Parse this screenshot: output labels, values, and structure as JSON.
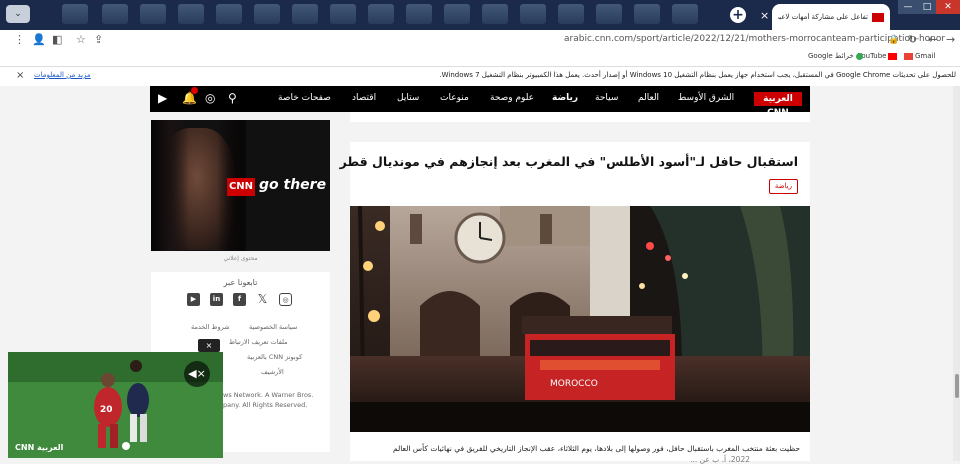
{
  "browser": {
    "tab_title": "تفاعل على مشاركة أمهات لاعبي المغرب ب...",
    "url": "arabic.cnn.com/sport/article/2022/12/21/mothers-morrocanteam-participation-honor",
    "new_tab": "+",
    "tab_close": "×",
    "window_controls": [
      "—",
      "□",
      "✕"
    ],
    "bookmarks": [
      {
        "label": "Gmail",
        "color": "#ea4335"
      },
      {
        "label": "YouTube",
        "color": "#ff0000"
      },
      {
        "label": "Google خرائط",
        "color": "#34a853"
      }
    ],
    "toolbar_icons": [
      "more-icon",
      "profile-icon",
      "sidebar-icon",
      "star-icon",
      "share-icon",
      "lock-icon",
      "reload-icon",
      "back-icon",
      "forward-icon"
    ]
  },
  "infobar": {
    "message": "للحصول على تحديثات Google Chrome في المستقبل، يجب استخدام جهاز يعمل بنظام التشغيل Windows 10 أو إصدار أحدث. يعمل هذا الكمبيوتر بنظام التشغيل Windows 7.",
    "link": "مزيد من المعلومات",
    "close": "×"
  },
  "nav": {
    "logo": "العربية CNN",
    "items": [
      "الشرق الأوسط",
      "العالم",
      "سياحة",
      "رياضة",
      "علوم وصحة",
      "منوعات",
      "ستايل",
      "اقتصاد",
      "صفحات خاصة"
    ],
    "active": "رياضة",
    "icons": [
      "search-icon",
      "user-icon",
      "bell-icon",
      "video-icon"
    ]
  },
  "sidebar": {
    "ad_cnn": "CNN",
    "ad_text": "go there",
    "ad_label": "محتوى إعلاني",
    "follow_title": "تابعونا عبر",
    "social_icons": [
      "youtube-icon",
      "linkedin-icon",
      "facebook-icon",
      "x-icon",
      "instagram-icon"
    ],
    "footer_links": [
      "شروط الخدمة",
      "سياسة الخصوصية",
      "ملفات تعريف الارتباط",
      "كوبونز CNN بالعربية",
      "الأرشيف"
    ],
    "copyright": [
      "ws Network. A Warner Bros.",
      "pany. All Rights Reserved."
    ]
  },
  "article": {
    "title": "استقبال حافل لـ\"أسود الأطلس\" في المغرب بعد إنجازهم في مونديال قطر",
    "tag": "رياضة",
    "caption": "حظيت بعثة منتخب المغرب باستقبال حافل، فور وصولها إلى بلادها، يوم الثلاثاء، عقب الإنجاز التاريخي للفريق في نهائيات كأس العالم",
    "caption2": "2022، أ. ب عن ...",
    "photo_bus_text": "MOROCCO"
  },
  "video": {
    "close": "×",
    "mute": "◀×",
    "logo": "CNN العربية",
    "jersey": "20"
  }
}
